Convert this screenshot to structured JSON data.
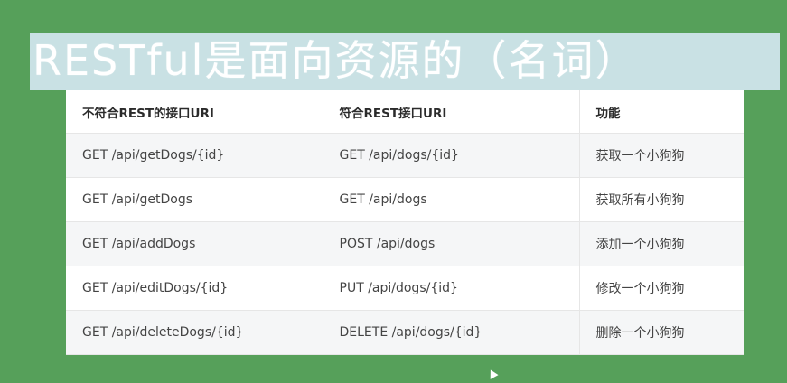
{
  "title": "RESTful是面向资源的（名词）",
  "table": {
    "headers": [
      "不符合REST的接口URI",
      "符合REST接口URI",
      "功能"
    ],
    "rows": [
      [
        "GET /api/getDogs/{id}",
        "GET /api/dogs/{id}",
        "获取一个小狗狗"
      ],
      [
        "GET /api/getDogs",
        "GET /api/dogs",
        "获取所有小狗狗"
      ],
      [
        "GET /api/addDogs",
        "POST /api/dogs",
        "添加一个小狗狗"
      ],
      [
        "GET /api/editDogs/{id}",
        "PUT /api/dogs/{id}",
        "修改一个小狗狗"
      ],
      [
        "GET /api/deleteDogs/{id}",
        "DELETE /api/dogs/{id}",
        "删除一个小狗狗"
      ]
    ]
  },
  "colors": {
    "background": "#56a05a",
    "banner": "#c9e1e4",
    "title_text": "#ffffff",
    "row_stripe": "#f5f6f7"
  }
}
